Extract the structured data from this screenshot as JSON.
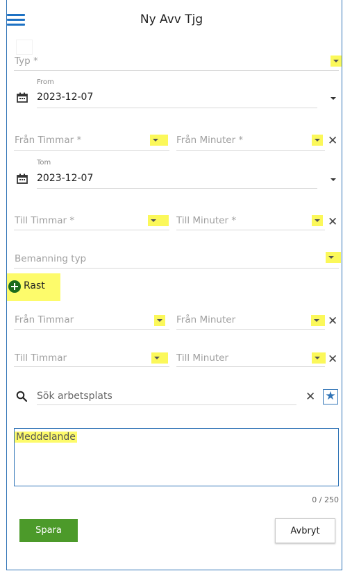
{
  "header": {
    "title": "Ny Avv Tjg",
    "menu_icon": "hamburger-menu-icon"
  },
  "form": {
    "typ_label": "Typ *",
    "from": {
      "caption": "From",
      "date": "2023-12-07"
    },
    "fran_timmar_req": "Från Timmar *",
    "fran_minuter_req": "Från Minuter *",
    "tom": {
      "caption": "Tom",
      "date": "2023-12-07"
    },
    "till_timmar_req": "Till Timmar *",
    "till_minuter_req": "Till Minuter *",
    "bemanning_typ": "Bemanning typ",
    "rast_label": "Rast",
    "rast_fran_timmar": "Från Timmar",
    "rast_fran_minuter": "Från Minuter",
    "rast_till_timmar": "Till Timmar",
    "rast_till_minuter": "Till Minuter",
    "search_placeholder": "Sök arbetsplats",
    "meddelande_label": "Meddelande",
    "counter": "0 / 250"
  },
  "actions": {
    "save_label": "Spara",
    "cancel_label": "Avbryt"
  },
  "colors": {
    "accent": "#2f73b6",
    "highlight": "#fdfb6b",
    "save_button": "#4c9a2a",
    "rast_icon": "#1c6b1c"
  }
}
